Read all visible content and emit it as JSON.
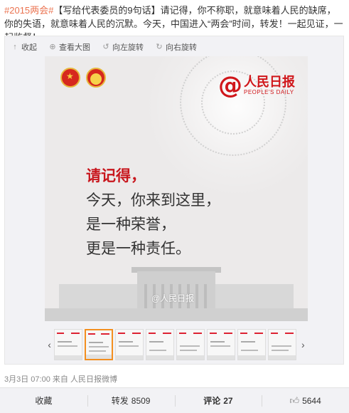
{
  "post": {
    "hashtag": "#2015两会#",
    "text": "【写给代表委员的9句话】请记得，你不称职，就意味着人民的缺席，你的失语，就意味着人民的沉默。今天，中国进入“两会”时间，转发！一起见证，一起监督！"
  },
  "toolbar": {
    "collapse": "收起",
    "view_large": "查看大图",
    "rotate_left": "向左旋转",
    "rotate_right": "向右旋转"
  },
  "poster": {
    "brand_cn": "人民日报",
    "brand_en": "PEOPLE'S DAILY",
    "line1": "请记得，",
    "line2": "今天，你来到这里，",
    "line3": "是一种荣誉，",
    "line4": "更是一种责任。",
    "watermark": "@人民日报"
  },
  "meta": {
    "date": "3月3日 07:00",
    "from_label": "来自",
    "source": "人民日报微博"
  },
  "actions": {
    "collect": "收藏",
    "repost_label": "转发",
    "repost_count": "8509",
    "comment_label": "评论",
    "comment_count": "27",
    "like_count": "5644"
  },
  "colors": {
    "hashtag": "#eb7350",
    "brand_red": "#d0161a",
    "thumb_active": "#f38f1f"
  }
}
